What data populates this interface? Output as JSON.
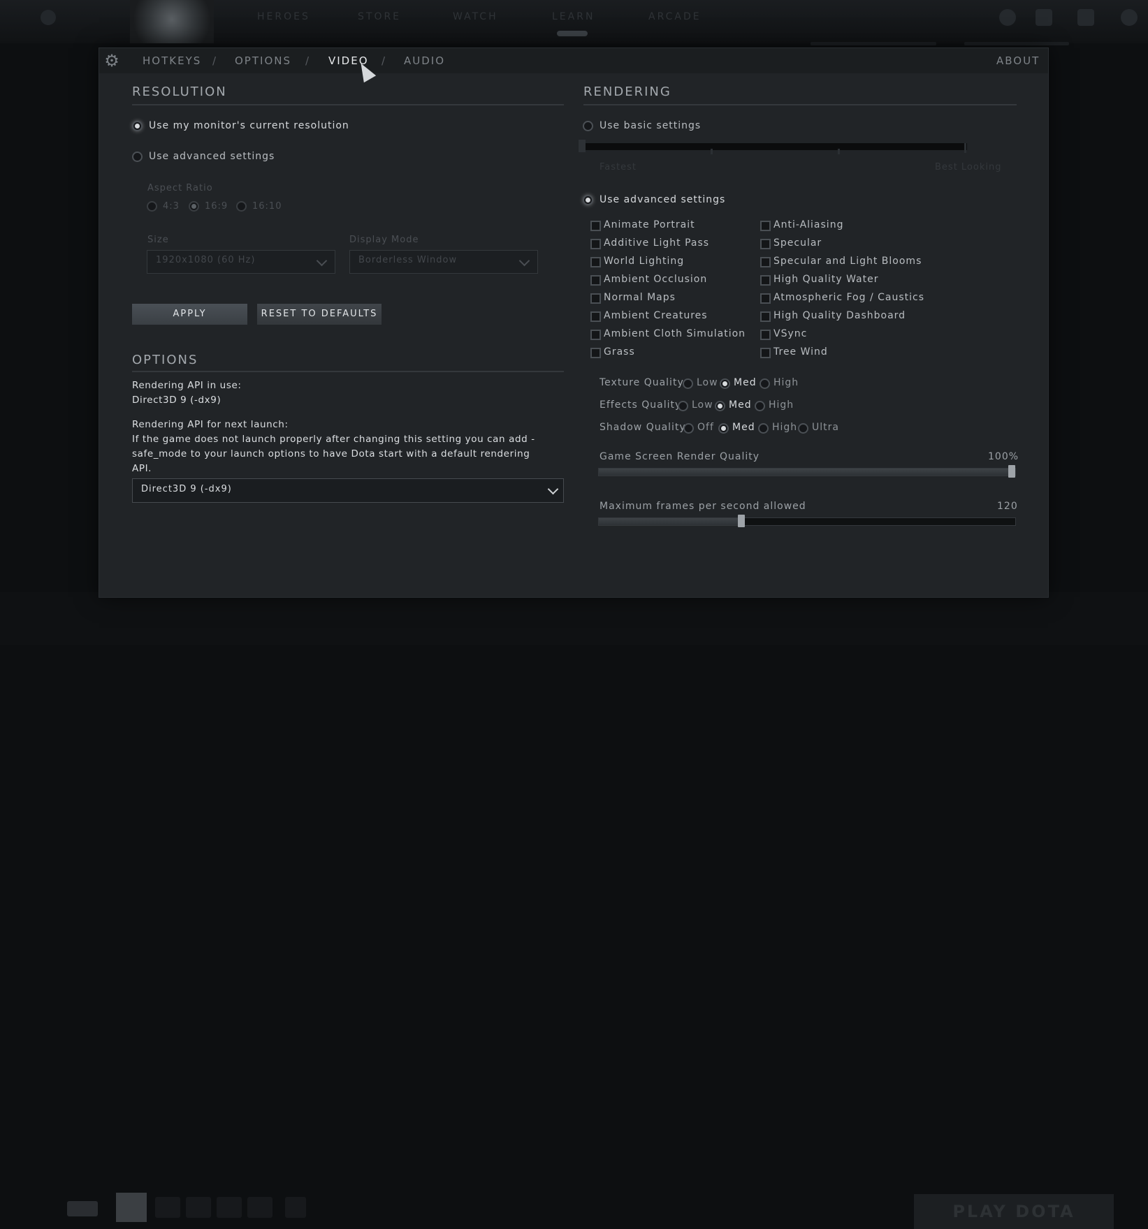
{
  "background": {
    "top_nav": [
      "HEROES",
      "STORE",
      "WATCH",
      "LEARN",
      "ARCADE"
    ],
    "play_button": "PLAY DOTA"
  },
  "tabs": {
    "hotkeys": "HOTKEYS",
    "options": "OPTIONS",
    "video": "VIDEO",
    "audio": "AUDIO",
    "about": "ABOUT",
    "separator": "/"
  },
  "resolution": {
    "title": "RESOLUTION",
    "monitor_label": "Use my monitor's current resolution",
    "advanced_label": "Use advanced settings",
    "selected": "monitor",
    "aspect_ratio_label": "Aspect Ratio",
    "aspect_options": [
      "4:3",
      "16:9",
      "16:10"
    ],
    "aspect_selected": "16:9",
    "size_label": "Size",
    "size_value": "1920x1080 (60 Hz)",
    "display_mode_label": "Display Mode",
    "display_mode_value": "Borderless Window",
    "apply_label": "APPLY",
    "reset_label": "RESET TO DEFAULTS"
  },
  "options": {
    "title": "OPTIONS",
    "api_in_use_label": "Rendering API in use:",
    "api_in_use_value": "Direct3D 9 (-dx9)",
    "api_next_label": "Rendering API for next launch:",
    "api_note_1": "If the game does not launch properly after changing this setting you can add -",
    "api_note_2": "safe_mode to your launch options to have Dota start with a default rendering",
    "api_note_3": "API.",
    "api_select_value": "Direct3D 9 (-dx9)"
  },
  "rendering": {
    "title": "RENDERING",
    "basic_label": "Use basic settings",
    "basic_min_label": "Fastest",
    "basic_max_label": "Best Looking",
    "advanced_label": "Use advanced settings",
    "selected": "advanced",
    "checkboxes_left": [
      "Animate Portrait",
      "Additive Light Pass",
      "World Lighting",
      "Ambient Occlusion",
      "Normal Maps",
      "Ambient Creatures",
      "Ambient Cloth Simulation",
      "Grass"
    ],
    "checkboxes_right": [
      "Anti-Aliasing",
      "Specular",
      "Specular and Light Blooms",
      "High Quality Water",
      "Atmospheric Fog / Caustics",
      "High Quality Dashboard",
      "VSync",
      "Tree Wind"
    ],
    "texture_quality": {
      "label": "Texture Quality",
      "options": [
        "Low",
        "Med",
        "High"
      ],
      "selected": "Med"
    },
    "effects_quality": {
      "label": "Effects Quality",
      "options": [
        "Low",
        "Med",
        "High"
      ],
      "selected": "Med"
    },
    "shadow_quality": {
      "label": "Shadow Quality",
      "options": [
        "Off",
        "Med",
        "High",
        "Ultra"
      ],
      "selected": "Med"
    },
    "render_quality": {
      "label": "Game Screen Render Quality",
      "value_text": "100%",
      "value": 1.0
    },
    "max_fps": {
      "label": "Maximum frames per second allowed",
      "value_text": "120",
      "value": 0.34
    }
  }
}
